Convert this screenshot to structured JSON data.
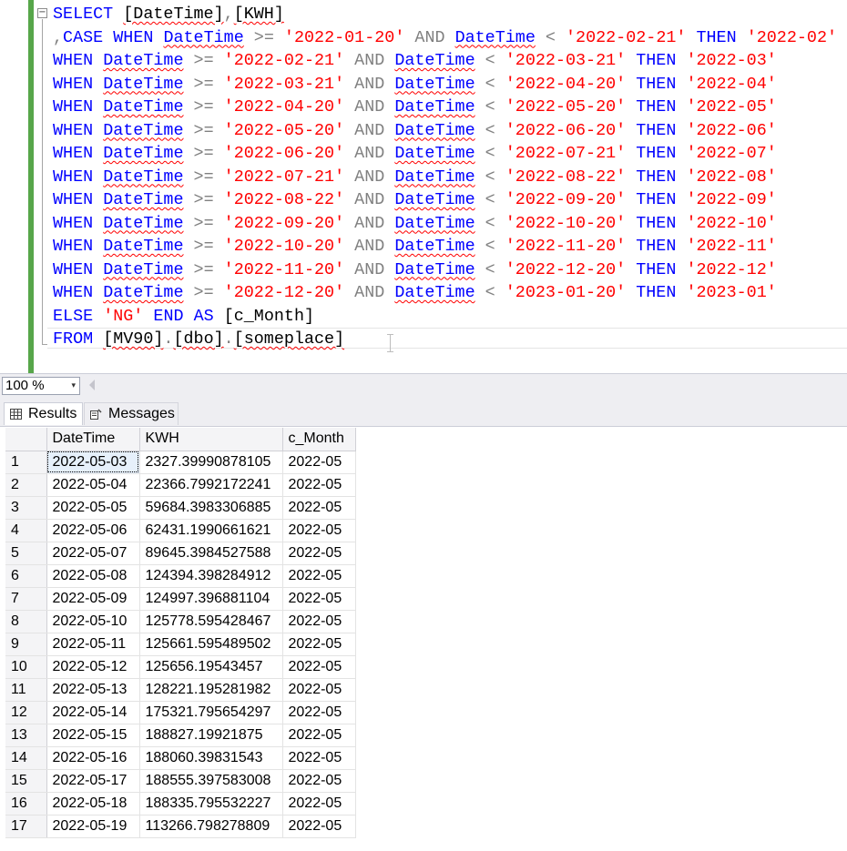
{
  "editor": {
    "collapse_glyph": "−",
    "lines": [
      [
        {
          "t": "SELECT",
          "c": "kw"
        },
        {
          "t": " "
        },
        {
          "t": "[DateTime]",
          "c": "sq"
        },
        {
          "t": ",",
          "c": "op"
        },
        {
          "t": "[KWH]",
          "c": "sq"
        }
      ],
      [
        {
          "t": ",",
          "c": "op"
        },
        {
          "t": "CASE",
          "c": "kw"
        },
        {
          "t": " "
        },
        {
          "t": "WHEN",
          "c": "kw"
        },
        {
          "t": " "
        },
        {
          "t": "DateTime",
          "c": "kw sq"
        },
        {
          "t": " "
        },
        {
          "t": ">=",
          "c": "op"
        },
        {
          "t": " "
        },
        {
          "t": "'2022-01-20'",
          "c": "str"
        },
        {
          "t": " "
        },
        {
          "t": "AND",
          "c": "op"
        },
        {
          "t": " "
        },
        {
          "t": "DateTime",
          "c": "kw sq"
        },
        {
          "t": " "
        },
        {
          "t": "<",
          "c": "op"
        },
        {
          "t": " "
        },
        {
          "t": "'2022-02-21'",
          "c": "str"
        },
        {
          "t": " "
        },
        {
          "t": "THEN",
          "c": "kw"
        },
        {
          "t": " "
        },
        {
          "t": "'2022-02'",
          "c": "str"
        }
      ],
      [
        {
          "t": "WHEN",
          "c": "kw"
        },
        {
          "t": " "
        },
        {
          "t": "DateTime",
          "c": "kw sq"
        },
        {
          "t": " "
        },
        {
          "t": ">=",
          "c": "op"
        },
        {
          "t": " "
        },
        {
          "t": "'2022-02-21'",
          "c": "str"
        },
        {
          "t": " "
        },
        {
          "t": "AND",
          "c": "op"
        },
        {
          "t": " "
        },
        {
          "t": "DateTime",
          "c": "kw sq"
        },
        {
          "t": " "
        },
        {
          "t": "<",
          "c": "op"
        },
        {
          "t": " "
        },
        {
          "t": "'2022-03-21'",
          "c": "str"
        },
        {
          "t": " "
        },
        {
          "t": "THEN",
          "c": "kw"
        },
        {
          "t": " "
        },
        {
          "t": "'2022-03'",
          "c": "str"
        }
      ],
      [
        {
          "t": "WHEN",
          "c": "kw"
        },
        {
          "t": " "
        },
        {
          "t": "DateTime",
          "c": "kw sq"
        },
        {
          "t": " "
        },
        {
          "t": ">=",
          "c": "op"
        },
        {
          "t": " "
        },
        {
          "t": "'2022-03-21'",
          "c": "str"
        },
        {
          "t": " "
        },
        {
          "t": "AND",
          "c": "op"
        },
        {
          "t": " "
        },
        {
          "t": "DateTime",
          "c": "kw sq"
        },
        {
          "t": " "
        },
        {
          "t": "<",
          "c": "op"
        },
        {
          "t": " "
        },
        {
          "t": "'2022-04-20'",
          "c": "str"
        },
        {
          "t": " "
        },
        {
          "t": "THEN",
          "c": "kw"
        },
        {
          "t": " "
        },
        {
          "t": "'2022-04'",
          "c": "str"
        }
      ],
      [
        {
          "t": "WHEN",
          "c": "kw"
        },
        {
          "t": " "
        },
        {
          "t": "DateTime",
          "c": "kw sq"
        },
        {
          "t": " "
        },
        {
          "t": ">=",
          "c": "op"
        },
        {
          "t": " "
        },
        {
          "t": "'2022-04-20'",
          "c": "str"
        },
        {
          "t": " "
        },
        {
          "t": "AND",
          "c": "op"
        },
        {
          "t": " "
        },
        {
          "t": "DateTime",
          "c": "kw sq"
        },
        {
          "t": " "
        },
        {
          "t": "<",
          "c": "op"
        },
        {
          "t": " "
        },
        {
          "t": "'2022-05-20'",
          "c": "str"
        },
        {
          "t": " "
        },
        {
          "t": "THEN",
          "c": "kw"
        },
        {
          "t": " "
        },
        {
          "t": "'2022-05'",
          "c": "str"
        }
      ],
      [
        {
          "t": "WHEN",
          "c": "kw"
        },
        {
          "t": " "
        },
        {
          "t": "DateTime",
          "c": "kw sq"
        },
        {
          "t": " "
        },
        {
          "t": ">=",
          "c": "op"
        },
        {
          "t": " "
        },
        {
          "t": "'2022-05-20'",
          "c": "str"
        },
        {
          "t": " "
        },
        {
          "t": "AND",
          "c": "op"
        },
        {
          "t": " "
        },
        {
          "t": "DateTime",
          "c": "kw sq"
        },
        {
          "t": " "
        },
        {
          "t": "<",
          "c": "op"
        },
        {
          "t": " "
        },
        {
          "t": "'2022-06-20'",
          "c": "str"
        },
        {
          "t": " "
        },
        {
          "t": "THEN",
          "c": "kw"
        },
        {
          "t": " "
        },
        {
          "t": "'2022-06'",
          "c": "str"
        }
      ],
      [
        {
          "t": "WHEN",
          "c": "kw"
        },
        {
          "t": " "
        },
        {
          "t": "DateTime",
          "c": "kw sq"
        },
        {
          "t": " "
        },
        {
          "t": ">=",
          "c": "op"
        },
        {
          "t": " "
        },
        {
          "t": "'2022-06-20'",
          "c": "str"
        },
        {
          "t": " "
        },
        {
          "t": "AND",
          "c": "op"
        },
        {
          "t": " "
        },
        {
          "t": "DateTime",
          "c": "kw sq"
        },
        {
          "t": " "
        },
        {
          "t": "<",
          "c": "op"
        },
        {
          "t": " "
        },
        {
          "t": "'2022-07-21'",
          "c": "str"
        },
        {
          "t": " "
        },
        {
          "t": "THEN",
          "c": "kw"
        },
        {
          "t": " "
        },
        {
          "t": "'2022-07'",
          "c": "str"
        }
      ],
      [
        {
          "t": "WHEN",
          "c": "kw"
        },
        {
          "t": " "
        },
        {
          "t": "DateTime",
          "c": "kw sq"
        },
        {
          "t": " "
        },
        {
          "t": ">=",
          "c": "op"
        },
        {
          "t": " "
        },
        {
          "t": "'2022-07-21'",
          "c": "str"
        },
        {
          "t": " "
        },
        {
          "t": "AND",
          "c": "op"
        },
        {
          "t": " "
        },
        {
          "t": "DateTime",
          "c": "kw sq"
        },
        {
          "t": " "
        },
        {
          "t": "<",
          "c": "op"
        },
        {
          "t": " "
        },
        {
          "t": "'2022-08-22'",
          "c": "str"
        },
        {
          "t": " "
        },
        {
          "t": "THEN",
          "c": "kw"
        },
        {
          "t": " "
        },
        {
          "t": "'2022-08'",
          "c": "str"
        }
      ],
      [
        {
          "t": "WHEN",
          "c": "kw"
        },
        {
          "t": " "
        },
        {
          "t": "DateTime",
          "c": "kw sq"
        },
        {
          "t": " "
        },
        {
          "t": ">=",
          "c": "op"
        },
        {
          "t": " "
        },
        {
          "t": "'2022-08-22'",
          "c": "str"
        },
        {
          "t": " "
        },
        {
          "t": "AND",
          "c": "op"
        },
        {
          "t": " "
        },
        {
          "t": "DateTime",
          "c": "kw sq"
        },
        {
          "t": " "
        },
        {
          "t": "<",
          "c": "op"
        },
        {
          "t": " "
        },
        {
          "t": "'2022-09-20'",
          "c": "str"
        },
        {
          "t": " "
        },
        {
          "t": "THEN",
          "c": "kw"
        },
        {
          "t": " "
        },
        {
          "t": "'2022-09'",
          "c": "str"
        }
      ],
      [
        {
          "t": "WHEN",
          "c": "kw"
        },
        {
          "t": " "
        },
        {
          "t": "DateTime",
          "c": "kw sq"
        },
        {
          "t": " "
        },
        {
          "t": ">=",
          "c": "op"
        },
        {
          "t": " "
        },
        {
          "t": "'2022-09-20'",
          "c": "str"
        },
        {
          "t": " "
        },
        {
          "t": "AND",
          "c": "op"
        },
        {
          "t": " "
        },
        {
          "t": "DateTime",
          "c": "kw sq"
        },
        {
          "t": " "
        },
        {
          "t": "<",
          "c": "op"
        },
        {
          "t": " "
        },
        {
          "t": "'2022-10-20'",
          "c": "str"
        },
        {
          "t": " "
        },
        {
          "t": "THEN",
          "c": "kw"
        },
        {
          "t": " "
        },
        {
          "t": "'2022-10'",
          "c": "str"
        }
      ],
      [
        {
          "t": "WHEN",
          "c": "kw"
        },
        {
          "t": " "
        },
        {
          "t": "DateTime",
          "c": "kw sq"
        },
        {
          "t": " "
        },
        {
          "t": ">=",
          "c": "op"
        },
        {
          "t": " "
        },
        {
          "t": "'2022-10-20'",
          "c": "str"
        },
        {
          "t": " "
        },
        {
          "t": "AND",
          "c": "op"
        },
        {
          "t": " "
        },
        {
          "t": "DateTime",
          "c": "kw sq"
        },
        {
          "t": " "
        },
        {
          "t": "<",
          "c": "op"
        },
        {
          "t": " "
        },
        {
          "t": "'2022-11-20'",
          "c": "str"
        },
        {
          "t": " "
        },
        {
          "t": "THEN",
          "c": "kw"
        },
        {
          "t": " "
        },
        {
          "t": "'2022-11'",
          "c": "str"
        }
      ],
      [
        {
          "t": "WHEN",
          "c": "kw"
        },
        {
          "t": " "
        },
        {
          "t": "DateTime",
          "c": "kw sq"
        },
        {
          "t": " "
        },
        {
          "t": ">=",
          "c": "op"
        },
        {
          "t": " "
        },
        {
          "t": "'2022-11-20'",
          "c": "str"
        },
        {
          "t": " "
        },
        {
          "t": "AND",
          "c": "op"
        },
        {
          "t": " "
        },
        {
          "t": "DateTime",
          "c": "kw sq"
        },
        {
          "t": " "
        },
        {
          "t": "<",
          "c": "op"
        },
        {
          "t": " "
        },
        {
          "t": "'2022-12-20'",
          "c": "str"
        },
        {
          "t": " "
        },
        {
          "t": "THEN",
          "c": "kw"
        },
        {
          "t": " "
        },
        {
          "t": "'2022-12'",
          "c": "str"
        }
      ],
      [
        {
          "t": "WHEN",
          "c": "kw"
        },
        {
          "t": " "
        },
        {
          "t": "DateTime",
          "c": "kw sq"
        },
        {
          "t": " "
        },
        {
          "t": ">=",
          "c": "op"
        },
        {
          "t": " "
        },
        {
          "t": "'2022-12-20'",
          "c": "str"
        },
        {
          "t": " "
        },
        {
          "t": "AND",
          "c": "op"
        },
        {
          "t": " "
        },
        {
          "t": "DateTime",
          "c": "kw sq"
        },
        {
          "t": " "
        },
        {
          "t": "<",
          "c": "op"
        },
        {
          "t": " "
        },
        {
          "t": "'2023-01-20'",
          "c": "str"
        },
        {
          "t": " "
        },
        {
          "t": "THEN",
          "c": "kw"
        },
        {
          "t": " "
        },
        {
          "t": "'2023-01'",
          "c": "str"
        }
      ],
      [
        {
          "t": "ELSE",
          "c": "kw"
        },
        {
          "t": " "
        },
        {
          "t": "'NG'",
          "c": "str"
        },
        {
          "t": " "
        },
        {
          "t": "END",
          "c": "kw"
        },
        {
          "t": " "
        },
        {
          "t": "AS",
          "c": "kw"
        },
        {
          "t": " "
        },
        {
          "t": "[c_Month]"
        }
      ],
      [
        {
          "t": "FROM",
          "c": "kw"
        },
        {
          "t": " "
        },
        {
          "t": "[MV90]",
          "c": "sq"
        },
        {
          "t": ".",
          "c": "op"
        },
        {
          "t": "[dbo]",
          "c": "sq"
        },
        {
          "t": ".",
          "c": "op"
        },
        {
          "t": "[someplace]",
          "c": "sq"
        }
      ]
    ]
  },
  "zoom": {
    "value": "100 %",
    "arrow_glyph": "▾"
  },
  "tabs": {
    "results": "Results",
    "messages": "Messages"
  },
  "grid": {
    "columns": [
      "DateTime",
      "KWH",
      "c_Month"
    ],
    "rows": [
      [
        "1",
        "2022-05-03",
        "2327.39990878105",
        "2022-05"
      ],
      [
        "2",
        "2022-05-04",
        "22366.7992172241",
        "2022-05"
      ],
      [
        "3",
        "2022-05-05",
        "59684.3983306885",
        "2022-05"
      ],
      [
        "4",
        "2022-05-06",
        "62431.1990661621",
        "2022-05"
      ],
      [
        "5",
        "2022-05-07",
        "89645.3984527588",
        "2022-05"
      ],
      [
        "6",
        "2022-05-08",
        "124394.398284912",
        "2022-05"
      ],
      [
        "7",
        "2022-05-09",
        "124997.396881104",
        "2022-05"
      ],
      [
        "8",
        "2022-05-10",
        "125778.595428467",
        "2022-05"
      ],
      [
        "9",
        "2022-05-11",
        "125661.595489502",
        "2022-05"
      ],
      [
        "10",
        "2022-05-12",
        "125656.19543457",
        "2022-05"
      ],
      [
        "11",
        "2022-05-13",
        "128221.195281982",
        "2022-05"
      ],
      [
        "12",
        "2022-05-14",
        "175321.795654297",
        "2022-05"
      ],
      [
        "13",
        "2022-05-15",
        "188827.19921875",
        "2022-05"
      ],
      [
        "14",
        "2022-05-16",
        "188060.39831543",
        "2022-05"
      ],
      [
        "15",
        "2022-05-17",
        "188555.397583008",
        "2022-05"
      ],
      [
        "16",
        "2022-05-18",
        "188335.795532227",
        "2022-05"
      ],
      [
        "17",
        "2022-05-19",
        "113266.798278809",
        "2022-05"
      ]
    ]
  }
}
